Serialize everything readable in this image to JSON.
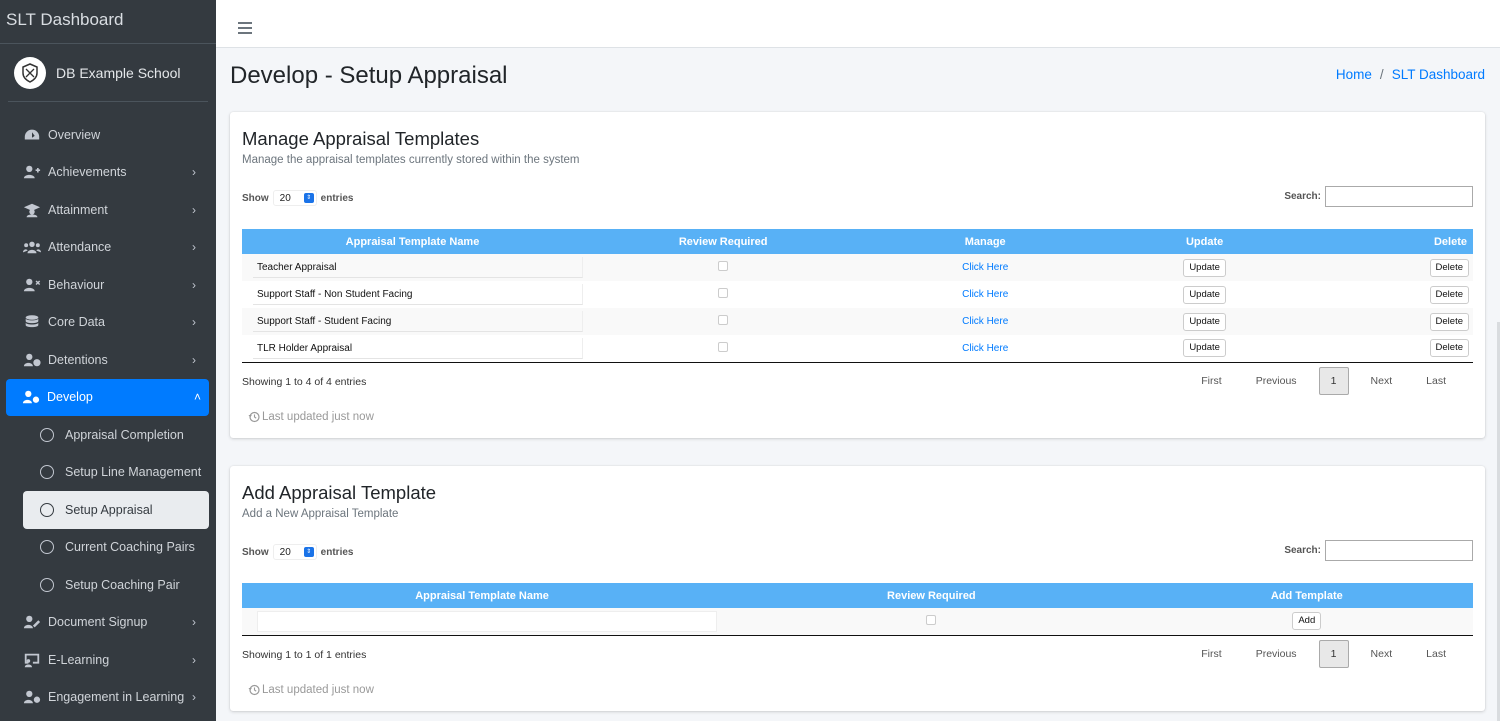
{
  "sidebar": {
    "brand": "SLT Dashboard",
    "school": "DB Example School",
    "items": [
      {
        "label": "Overview",
        "icon": "dashboard-icon",
        "chevron": false
      },
      {
        "label": "Achievements",
        "icon": "user-plus-icon",
        "chevron": true
      },
      {
        "label": "Attainment",
        "icon": "graduate-icon",
        "chevron": true
      },
      {
        "label": "Attendance",
        "icon": "users-icon",
        "chevron": true
      },
      {
        "label": "Behaviour",
        "icon": "user-times-icon",
        "chevron": true
      },
      {
        "label": "Core Data",
        "icon": "database-icon",
        "chevron": true
      },
      {
        "label": "Detentions",
        "icon": "user-clock-icon",
        "chevron": true
      },
      {
        "label": "Develop",
        "icon": "user-cog-icon",
        "chevron": true,
        "expanded": true
      },
      {
        "label": "Document Signup",
        "icon": "user-edit-icon",
        "chevron": true
      },
      {
        "label": "E-Learning",
        "icon": "chalkboard-icon",
        "chevron": true
      },
      {
        "label": "Engagement in Learning",
        "icon": "user-cog-icon",
        "chevron": true
      }
    ],
    "develop_sub": [
      {
        "label": "Appraisal Completion"
      },
      {
        "label": "Setup Line Management"
      },
      {
        "label": "Setup Appraisal",
        "current": true
      },
      {
        "label": "Current Coaching Pairs"
      },
      {
        "label": "Setup Coaching Pair"
      }
    ]
  },
  "header": {
    "title": "Develop - Setup Appraisal",
    "breadcrumb": [
      "Home",
      "SLT Dashboard"
    ]
  },
  "manage": {
    "title": "Manage Appraisal Templates",
    "subtitle": "Manage the appraisal templates currently stored within the system",
    "show_label": "Show",
    "entries_value": "20",
    "entries_label": "entries",
    "search_label": "Search:",
    "columns": [
      "Appraisal Template Name",
      "Review Required",
      "Manage",
      "Update",
      "Delete"
    ],
    "rows": [
      {
        "name": "Teacher Appraisal",
        "manage": "Click Here",
        "update": "Update",
        "delete": "Delete"
      },
      {
        "name": "Support Staff - Non Student Facing",
        "manage": "Click Here",
        "update": "Update",
        "delete": "Delete"
      },
      {
        "name": "Support Staff - Student Facing",
        "manage": "Click Here",
        "update": "Update",
        "delete": "Delete"
      },
      {
        "name": "TLR Holder Appraisal",
        "manage": "Click Here",
        "update": "Update",
        "delete": "Delete"
      }
    ],
    "info": "Showing 1 to 4 of 4 entries",
    "pager": {
      "first": "First",
      "previous": "Previous",
      "current": "1",
      "next": "Next",
      "last": "Last"
    },
    "updated": "Last updated just now"
  },
  "add": {
    "title": "Add Appraisal Template",
    "subtitle": "Add a New Appraisal Template",
    "show_label": "Show",
    "entries_value": "20",
    "entries_label": "entries",
    "search_label": "Search:",
    "columns": [
      "Appraisal Template Name",
      "Review Required",
      "Add Template"
    ],
    "add_button": "Add",
    "info": "Showing 1 to 1 of 1 entries",
    "pager": {
      "first": "First",
      "previous": "Previous",
      "current": "1",
      "next": "Next",
      "last": "Last"
    },
    "updated": "Last updated just now"
  },
  "colors": {
    "accent": "#007bff",
    "table_header": "#58b1f6",
    "sidebar": "#343a40"
  }
}
